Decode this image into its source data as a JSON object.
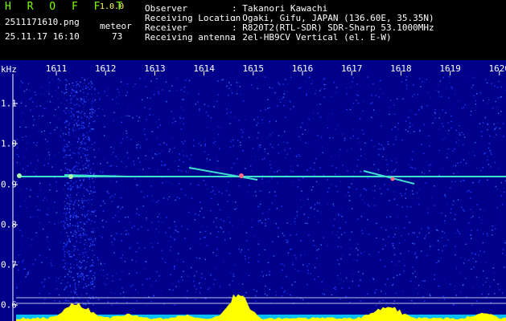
{
  "header": {
    "app_title": "H R O F F T",
    "version": "1.0.0",
    "filename": "2511171610.png",
    "datetime": "25.11.17 16:10",
    "meteor_label": "meteor",
    "meteor_count": "73",
    "fields": [
      {
        "label": "Observer",
        "value": ": Takanori Kawachi"
      },
      {
        "label": "Receiving Location",
        "value": ": Ogaki, Gifu, JAPAN (136.60E, 35.35N)"
      },
      {
        "label": "Receiver",
        "value": ": R820T2(RTL-SDR) SDR-Sharp 53.1000MHz"
      },
      {
        "label": "Receiving antenna",
        "value": ": 2el-HB9CV Vertical (el. E-W)"
      }
    ]
  },
  "spectrogram": {
    "y_unit": "kHz",
    "x_ticks": [
      "1611",
      "1612",
      "1613",
      "1614",
      "1615",
      "1616",
      "1617",
      "1618",
      "1619",
      "1620"
    ],
    "y_ticks": [
      "1.1",
      "1.0",
      "0.9",
      "0.8",
      "0.7",
      "0.6"
    ],
    "colors": {
      "background": "#00008b",
      "carrier": "#40e0d0",
      "bar": "#ffff00",
      "base": "#00bfff"
    }
  }
}
